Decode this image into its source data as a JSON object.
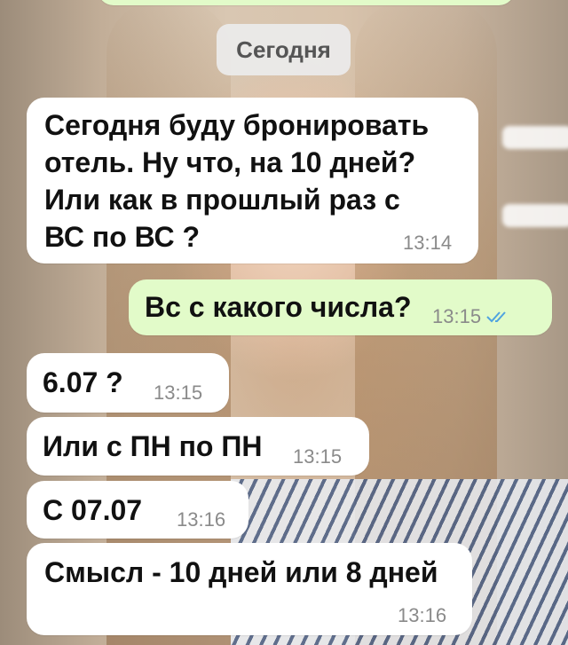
{
  "chat": {
    "date_label": "Сегодня",
    "messages": [
      {
        "direction": "incoming",
        "lines": [
          "Сегодня буду бронировать",
          "отель. Ну что, на 10 дней?",
          "Или как в прошлый раз с",
          "ВС по ВС ?"
        ],
        "time": "13:14"
      },
      {
        "direction": "outgoing",
        "text": "Вс с какого числа?",
        "time": "13:15",
        "status_icon": "double-check-icon"
      },
      {
        "direction": "incoming",
        "text": "6.07 ?",
        "time": "13:15"
      },
      {
        "direction": "incoming",
        "text": "Или с ПН по ПН",
        "time": "13:15"
      },
      {
        "direction": "incoming",
        "text": "С 07.07",
        "time": "13:16"
      },
      {
        "direction": "incoming",
        "text": "Смысл - 10 дней или 8 дней",
        "time": "13:16"
      }
    ]
  },
  "colors": {
    "incoming_bubble": "#ffffff",
    "outgoing_bubble": "#e2fbc9",
    "timestamp": "#8a8a8a",
    "read_check": "#4fa3e0"
  }
}
